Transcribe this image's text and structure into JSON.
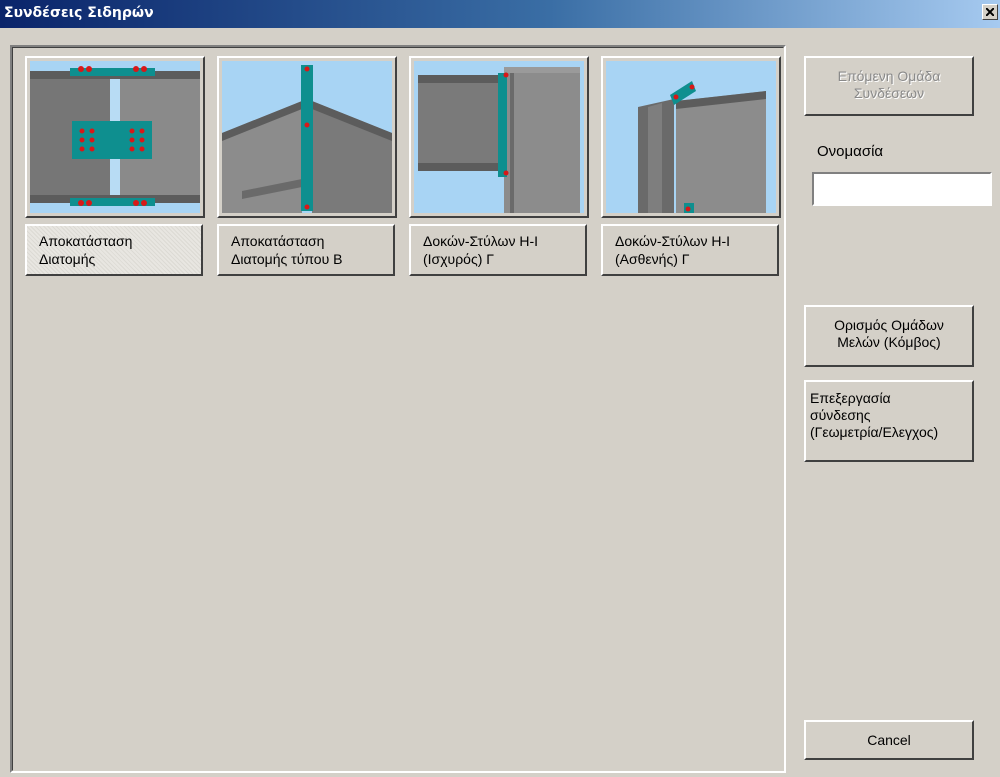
{
  "window": {
    "title": "Συνδέσεις Σιδηρών",
    "close_label": "X"
  },
  "connections": [
    {
      "line1": "Αποκατάσταση",
      "line2": "Διατομής",
      "icon": "section-restoration-connection-icon",
      "selected": true
    },
    {
      "line1": "Αποκατάσταση",
      "line2": "Διατομής τύπου Β",
      "icon": "section-restoration-type-b-connection-icon",
      "selected": false
    },
    {
      "line1": "Δοκών-Στύλων Η-Ι",
      "line2": "(Ισχυρός) Γ",
      "icon": "beam-column-strong-axis-connection-icon",
      "selected": false
    },
    {
      "line1": "Δοκών-Στύλων Η-Ι",
      "line2": "(Ασθενής) Γ",
      "icon": "beam-column-weak-axis-connection-icon",
      "selected": false
    }
  ],
  "side_panel": {
    "next_group": {
      "line1": "Επόμενη Ομάδα",
      "line2": "Συνδέσεων",
      "enabled": false
    },
    "name_label": "Ονομασία",
    "name_value": "",
    "define_groups": {
      "line1": "Ορισμός Ομάδων",
      "line2": "Μελών (Κόμβος)"
    },
    "edit_connection": {
      "line1": "Επεξεργασία",
      "line2": "σύνδεσης",
      "line3": "(Γεωμετρία/Ελεγχος)"
    },
    "cancel_label": "Cancel"
  },
  "colors": {
    "title_bar": "#0a246a",
    "dialog_bg": "#d4d0c8",
    "steel": "#7b7b7b",
    "plate": "#0e8f8f",
    "bolt": "#d81818",
    "sky": "#a8d4f4"
  }
}
